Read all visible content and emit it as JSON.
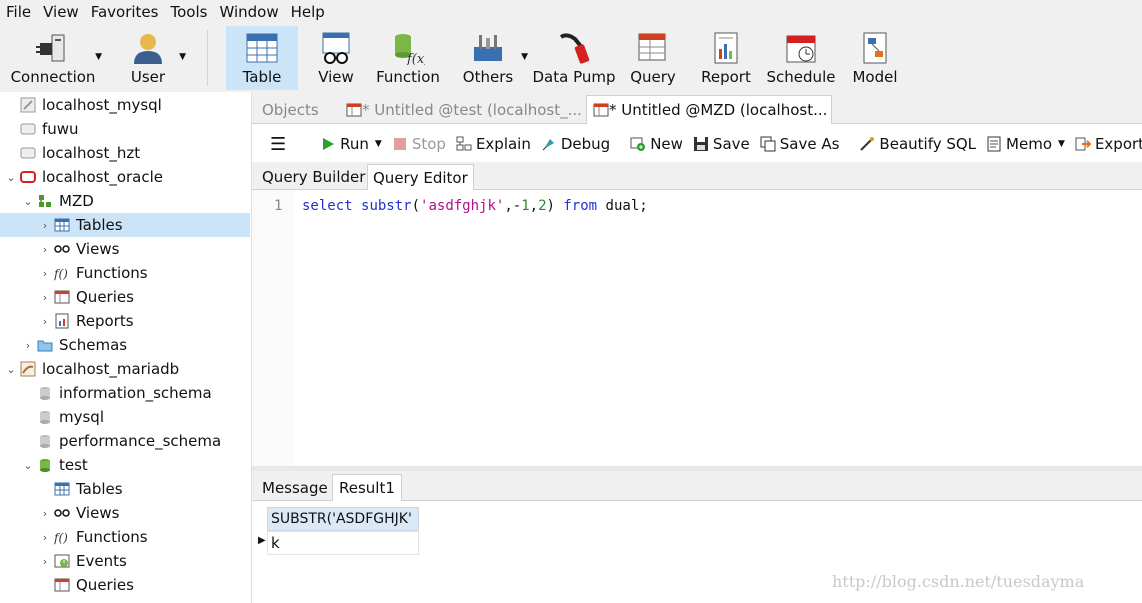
{
  "menu": [
    "File",
    "View",
    "Favorites",
    "Tools",
    "Window",
    "Help"
  ],
  "toolbar": {
    "connection": "Connection",
    "user": "User",
    "table": "Table",
    "view": "View",
    "function": "Function",
    "others": "Others",
    "data_pump": "Data Pump",
    "query": "Query",
    "report": "Report",
    "schedule": "Schedule",
    "model": "Model"
  },
  "sidebar": {
    "items": [
      {
        "label": "localhost_mysql"
      },
      {
        "label": "fuwu"
      },
      {
        "label": "localhost_hzt"
      },
      {
        "label": "localhost_oracle"
      },
      {
        "label": "MZD"
      },
      {
        "label": "Tables"
      },
      {
        "label": "Views"
      },
      {
        "label": "Functions"
      },
      {
        "label": "Queries"
      },
      {
        "label": "Reports"
      },
      {
        "label": "Schemas"
      },
      {
        "label": "localhost_mariadb"
      },
      {
        "label": "information_schema"
      },
      {
        "label": "mysql"
      },
      {
        "label": "performance_schema"
      },
      {
        "label": "test"
      },
      {
        "label": "Tables"
      },
      {
        "label": "Views"
      },
      {
        "label": "Functions"
      },
      {
        "label": "Events"
      },
      {
        "label": "Queries"
      }
    ]
  },
  "tabs": {
    "objects": "Objects",
    "tab1": "* Untitled @test (localhost_...",
    "tab2": "* Untitled @MZD (localhost..."
  },
  "query_toolbar": {
    "run": "Run",
    "stop": "Stop",
    "explain": "Explain",
    "debug": "Debug",
    "new": "New",
    "save": "Save",
    "save_as": "Save As",
    "beautify": "Beautify SQL",
    "memo": "Memo",
    "export": "Export"
  },
  "subtabs": {
    "builder": "Query Builder",
    "editor": "Query Editor"
  },
  "editor": {
    "line_no": "1",
    "kw_select": "select",
    "fn": "substr",
    "open": "(",
    "str": "'asdfghjk'",
    "comma1": ",-",
    "n1": "1",
    "comma2": ",",
    "n2": "2",
    "close": ")",
    "kw_from": "from",
    "rest": "dual;"
  },
  "result_tabs": {
    "message": "Message",
    "result1": "Result1"
  },
  "result": {
    "column": "SUBSTR('ASDFGHJK'",
    "value": "k"
  },
  "watermark": "http://blog.csdn.net/tuesdayma"
}
